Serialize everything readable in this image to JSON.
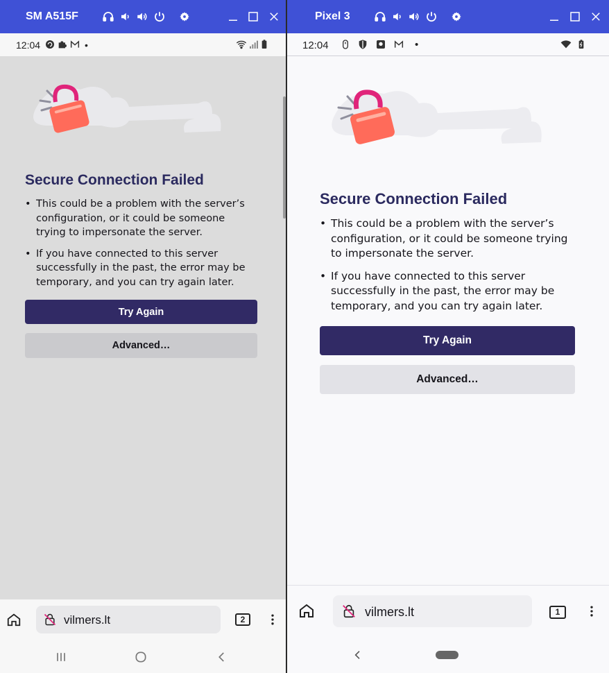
{
  "left": {
    "device_name": "SM A515F",
    "status": {
      "time": "12:04"
    },
    "error": {
      "title": "Secure Connection Failed",
      "bullets": [
        "This could be a problem with the server’s configuration, or it could be someone trying to impersonate the server.",
        "If you have connected to this server successfully in the past, the error may be temporary, and you can try again later."
      ]
    },
    "buttons": {
      "try_again": "Try Again",
      "advanced": "Advanced…"
    },
    "toolbar": {
      "url": "vilmers.lt",
      "tab_count": "2"
    }
  },
  "right": {
    "device_name": "Pixel 3",
    "status": {
      "time": "12:04"
    },
    "error": {
      "title": "Secure Connection Failed",
      "bullets": [
        "This could be a problem with the server’s configuration, or it could be someone trying to impersonate the server.",
        "If you have connected to this server successfully in the past, the error may be temporary, and you can try again later."
      ]
    },
    "buttons": {
      "try_again": "Try Again",
      "advanced": "Advanced…"
    },
    "toolbar": {
      "url": "vilmers.lt",
      "tab_count": "1"
    }
  },
  "colors": {
    "titlebar": "#3f51d6",
    "primary_button": "#312a65",
    "title_text": "#2b2a5f",
    "lock_pink": "#e0247a",
    "lock_orange": "#ff6b3d"
  },
  "icons": [
    "headphones-icon",
    "volume-down-icon",
    "volume-up-icon",
    "power-icon",
    "settings-icon",
    "minimize-icon",
    "maximize-icon",
    "close-icon",
    "home-icon",
    "insecure-lock-icon",
    "overflow-menu-icon",
    "recents-icon",
    "home-circle-icon",
    "back-icon",
    "home-pill-icon"
  ]
}
